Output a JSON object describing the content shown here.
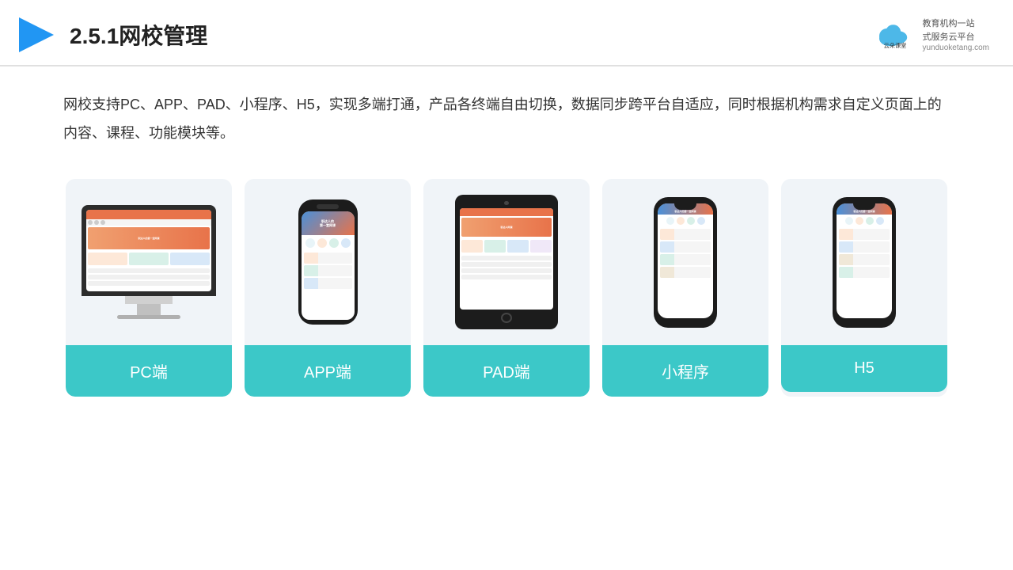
{
  "header": {
    "title": "2.5.1网校管理",
    "logo_name": "云朵课堂",
    "logo_site": "yunduoketang.com",
    "logo_tagline": "教育机构一站\n式服务云平台"
  },
  "description": "网校支持PC、APP、PAD、小程序、H5，实现多端打通，产品各终端自由切换，数据同步跨平台自适应，同时根据机构需求自定义页面上的内容、课程、功能模块等。",
  "cards": [
    {
      "id": "pc",
      "label": "PC端"
    },
    {
      "id": "app",
      "label": "APP端"
    },
    {
      "id": "pad",
      "label": "PAD端"
    },
    {
      "id": "miniprogram",
      "label": "小程序"
    },
    {
      "id": "h5",
      "label": "H5"
    }
  ]
}
